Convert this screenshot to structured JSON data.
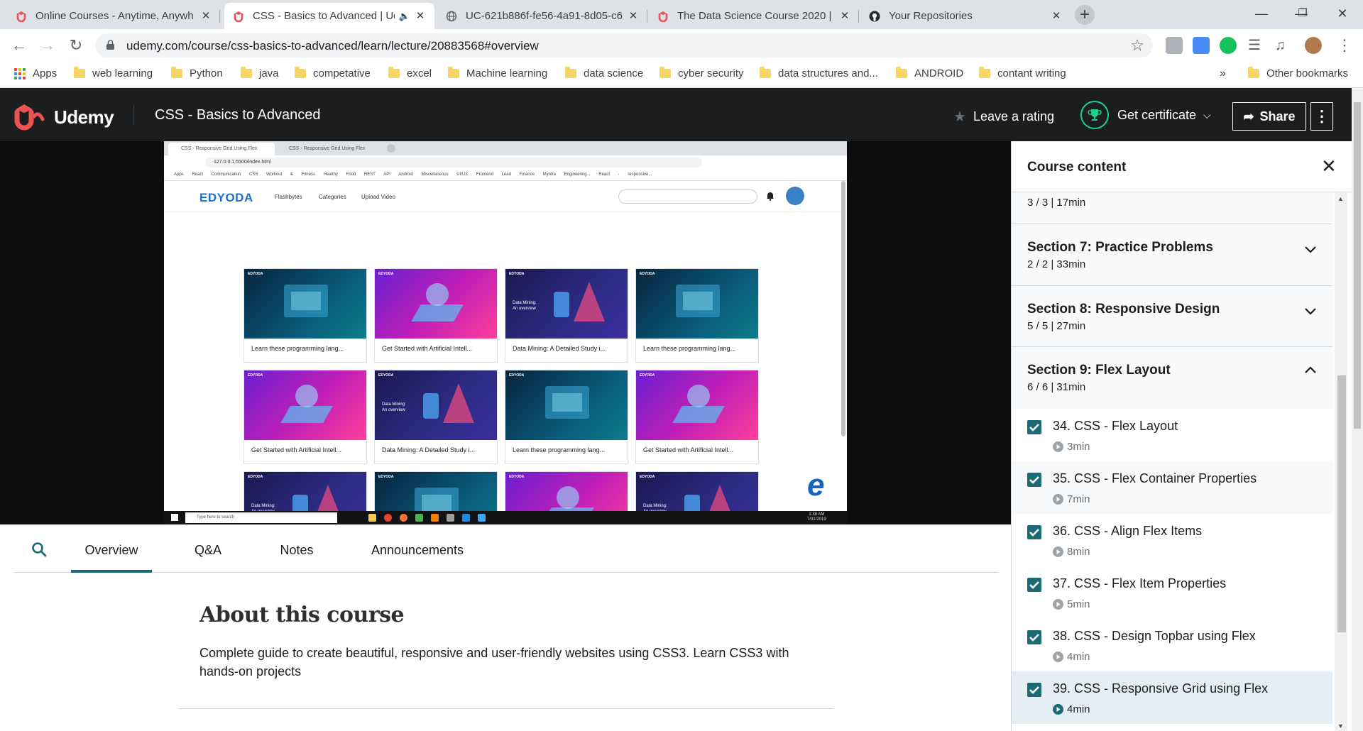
{
  "browser": {
    "tabs": [
      {
        "title": "Online Courses - Anytime, Anywh",
        "favicon": "udemy-icon"
      },
      {
        "title": "CSS - Basics to Advanced | Ud",
        "favicon": "udemy-icon",
        "active": true,
        "audio": true
      },
      {
        "title": "UC-621b886f-fe56-4a91-8d05-c6",
        "favicon": "globe-icon"
      },
      {
        "title": "The Data Science Course 2020 | U",
        "favicon": "udemy-icon"
      },
      {
        "title": "Your Repositories",
        "favicon": "github-icon"
      }
    ],
    "url": "udemy.com/course/css-basics-to-advanced/learn/lecture/20883568#overview",
    "bookmarks": [
      "Apps",
      "web learning",
      "Python",
      "java",
      "competative",
      "excel",
      "Machine learning",
      "data science",
      "cyber security",
      "data structures and...",
      "ANDROID",
      "contant writing"
    ],
    "bookmarks_more": "»",
    "other_bookmarks": "Other bookmarks"
  },
  "header": {
    "logo": "Udemy",
    "course_title": "CSS - Basics to Advanced",
    "leave_rating": "Leave a rating",
    "get_certificate": "Get certificate",
    "share": "Share"
  },
  "video": {
    "inner_tabs": [
      "CSS - Responsive Grid Using Flex",
      "CSS - Responsive Grid Using Flex"
    ],
    "inner_url": "127.0.0.1:5500/index.html",
    "inner_bookmarks": "Apps  React  Communication  CSS  Workout & Fitness  Healthy Food  REST API  Android  Miscellaneous  UI/UX  Frontend Lead  Finance  Myntra Engineering...  React - responsive...",
    "site_logo": "EDYODA",
    "site_nav": [
      "Flashbytes",
      "Categories",
      "Upload Video"
    ],
    "cards": [
      {
        "title": "Learn these programming lang...",
        "theme": "teal"
      },
      {
        "title": "Get Started with Artificial Intell...",
        "theme": "pink"
      },
      {
        "title": "Data Mining: A Detailed Study i...",
        "theme": "navy",
        "thumb_text": "Data Mining:\nAn overview"
      },
      {
        "title": "Learn these programming lang...",
        "theme": "teal"
      },
      {
        "title": "Get Started with Artificial Intell...",
        "theme": "pink"
      },
      {
        "title": "Data Mining: A Detailed Study i...",
        "theme": "navy",
        "thumb_text": "Data Mining:\nAn overview"
      },
      {
        "title": "Learn these programming lang...",
        "theme": "teal"
      },
      {
        "title": "Get Started with Artificial Intell...",
        "theme": "pink"
      },
      {
        "title": "",
        "theme": "navy",
        "thumb_text": "Data Mining:\nAn overview"
      },
      {
        "title": "",
        "theme": "teal"
      },
      {
        "title": "",
        "theme": "pink"
      },
      {
        "title": "",
        "theme": "navy",
        "thumb_text": "Data Mining:\nAn overview"
      }
    ],
    "card_brand": "EDYODA",
    "taskbar_search": "Type here to search",
    "clock_time": "1:38 AM",
    "clock_date": "7/31/2019"
  },
  "content_tabs": [
    "Overview",
    "Q&A",
    "Notes",
    "Announcements"
  ],
  "about": {
    "heading": "About this course",
    "description": "Complete guide to create beautiful, responsive and user-friendly websites using CSS3. Learn CSS3 with hands-on projects"
  },
  "sidebar": {
    "title": "Course content",
    "partial_section_meta": "3 / 3 | 17min",
    "sections": [
      {
        "title": "Section 7: Practice Problems",
        "meta": "2 / 2 | 33min",
        "expanded": false
      },
      {
        "title": "Section 8: Responsive Design",
        "meta": "5 / 5 | 27min",
        "expanded": false
      },
      {
        "title": "Section 9: Flex Layout",
        "meta": "6 / 6 | 31min",
        "expanded": true
      }
    ],
    "lessons": [
      {
        "title": "34. CSS - Flex Layout",
        "duration": "3min",
        "completed": true
      },
      {
        "title": "35. CSS - Flex Container Properties",
        "duration": "7min",
        "completed": true
      },
      {
        "title": "36. CSS - Align Flex Items",
        "duration": "8min",
        "completed": true
      },
      {
        "title": "37. CSS - Flex Item Properties",
        "duration": "5min",
        "completed": true
      },
      {
        "title": "38. CSS - Design Topbar using Flex",
        "duration": "4min",
        "completed": true
      },
      {
        "title": "39. CSS - Responsive Grid using Flex",
        "duration": "4min",
        "completed": true,
        "current": true
      }
    ]
  },
  "colors": {
    "udemy_header": "#1c1d1f",
    "accent_teal": "#1c6a75",
    "udemy_red": "#ec5252",
    "certificate_green": "#19d38b"
  }
}
